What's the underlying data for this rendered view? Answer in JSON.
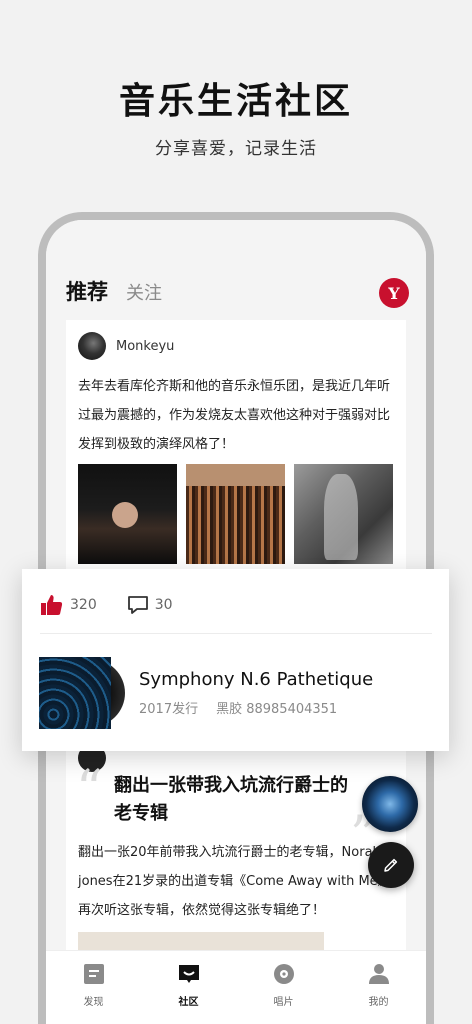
{
  "hero": {
    "title": "音乐生活社区",
    "subtitle": "分享喜爱，记录生活"
  },
  "header": {
    "tab_active": "推荐",
    "tab_other": "关注",
    "logo_text": "Y"
  },
  "post1": {
    "username": "Monkeyu",
    "text": "去年去看库伦齐斯和他的音乐永恒乐团，是我近几年听过最为震撼的，作为发烧友太喜欢他这种对于强弱对比发挥到极致的演绎风格了！"
  },
  "overlay": {
    "likes": "320",
    "comments": "30",
    "album_title": "Symphony N.6 Pathetique",
    "album_year": "2017发行",
    "album_format": "黑胶 88985404351"
  },
  "post2": {
    "title": "翻出一张带我入坑流行爵士的老专辑",
    "text": "翻出一张20年前带我入坑流行爵士的老专辑，Norah jones在21岁录的出道专辑《Come Away with Me》再次听这张专辑，依然觉得这张专辑绝了！"
  },
  "nav": {
    "items": [
      {
        "label": "发现",
        "icon": "discover-icon"
      },
      {
        "label": "社区",
        "icon": "community-icon"
      },
      {
        "label": "唱片",
        "icon": "record-icon"
      },
      {
        "label": "我的",
        "icon": "profile-icon"
      }
    ]
  },
  "colors": {
    "accent": "#c8102e",
    "like": "#c8102e",
    "dark": "#1a1a1a"
  }
}
